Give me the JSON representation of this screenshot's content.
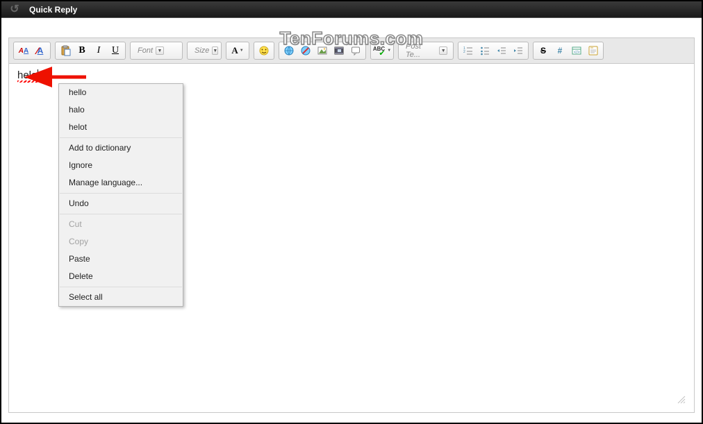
{
  "title": "Quick Reply",
  "watermark": "TenForums.com",
  "toolbar": {
    "switch_editor": "ᴬA",
    "bold": "B",
    "italic": "I",
    "underline": "U",
    "font_dd": "Font",
    "size_dd": "Size",
    "fontA": "A",
    "tmpl_dd": "Post Te...",
    "strike": "S",
    "hash": "#"
  },
  "typed_text": "helo",
  "context_menu": {
    "sugg1": "hello",
    "sugg2": "halo",
    "sugg3": "helot",
    "add_dict": "Add to dictionary",
    "ignore": "Ignore",
    "manage_lang": "Manage language...",
    "undo": "Undo",
    "cut": "Cut",
    "copy": "Copy",
    "paste": "Paste",
    "delete": "Delete",
    "select_all": "Select all"
  }
}
